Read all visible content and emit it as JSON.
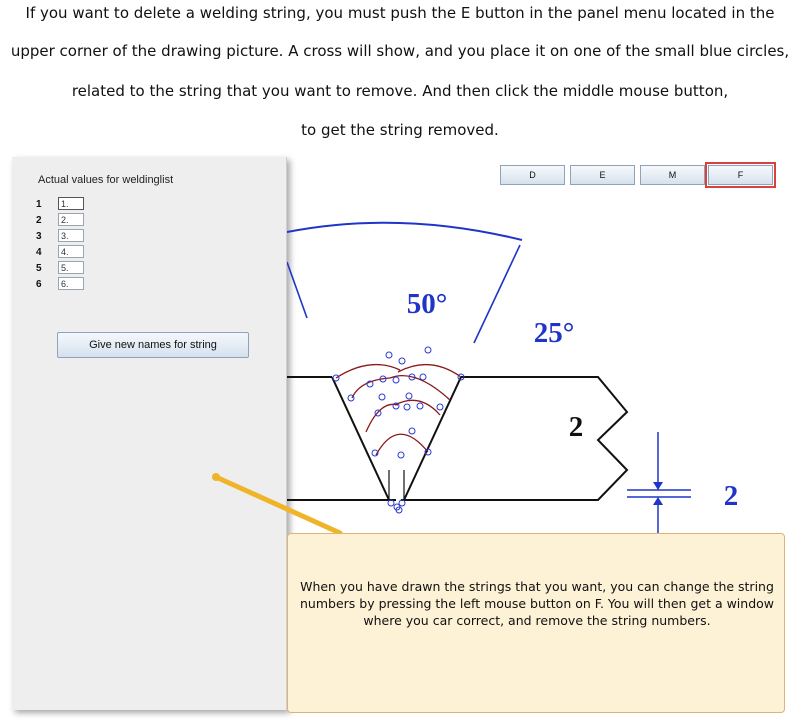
{
  "instructions": {
    "line1": "If you want to delete a welding string, you must push the E button in the panel menu located in the",
    "line2": "upper corner of the drawing picture. A cross will show, and you place it on one of the small blue circles,",
    "line3": "related to the string that you want to remove. And then click the middle mouse button,",
    "line4": "to get the string removed."
  },
  "panel": {
    "title": "Actual values for weldinglist",
    "rows": [
      {
        "num": "1",
        "value": "1."
      },
      {
        "num": "2",
        "value": "2."
      },
      {
        "num": "3",
        "value": "3."
      },
      {
        "num": "4",
        "value": "4."
      },
      {
        "num": "5",
        "value": "5."
      },
      {
        "num": "6",
        "value": "6."
      }
    ],
    "rename_button": "Give new names for string"
  },
  "toolbar": {
    "buttons": [
      "D",
      "E",
      "M",
      "F"
    ],
    "highlight_color": "#d9413f"
  },
  "drawing": {
    "angle_top": "50°",
    "angle_side": "25°",
    "dim_gap": "2",
    "dim_root": "2",
    "arc_color": "#1f35c8",
    "bead_color": "#8b1a1a",
    "circle_color": "#2a3bd0"
  },
  "callout": {
    "text": "When you have drawn the strings that you want, you can change the string numbers by pressing the left mouse button on F. You will then get a window where you car correct, and remove the string numbers."
  }
}
